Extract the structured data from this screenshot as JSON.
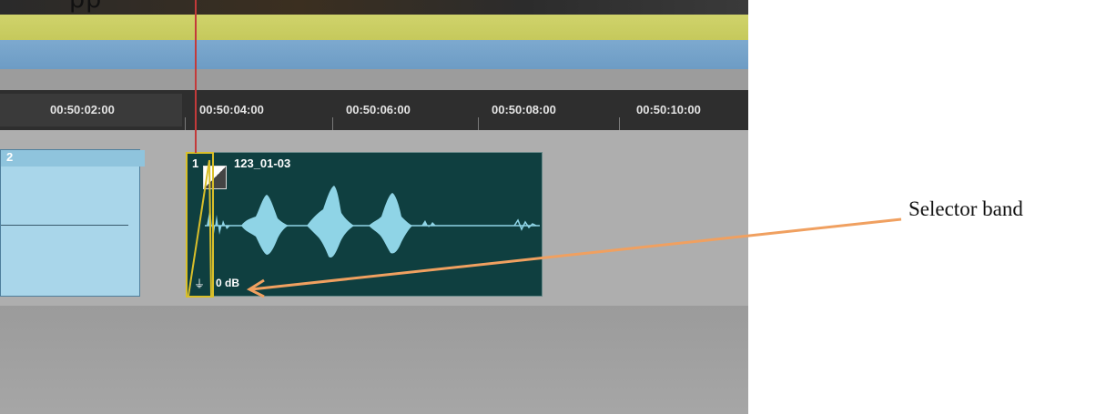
{
  "top_partial_text": "pp",
  "timeline": {
    "timecodes": [
      "00:50:02:00",
      "00:50:04:00",
      "00:50:06:00",
      "00:50:08:00",
      "00:50:10:00"
    ]
  },
  "clips": {
    "left_clip_label": "2",
    "main_clip": {
      "number": "1",
      "name": "123_01-03",
      "gain": "0 dB"
    }
  },
  "annotation": {
    "text": "Selector band",
    "arrow_color": "#f0a060"
  },
  "colors": {
    "playhead": "#c33a3a",
    "selector_band": "#d9bf2a",
    "waveform": "#8fd4e6",
    "clip_background": "#0f3f40"
  }
}
